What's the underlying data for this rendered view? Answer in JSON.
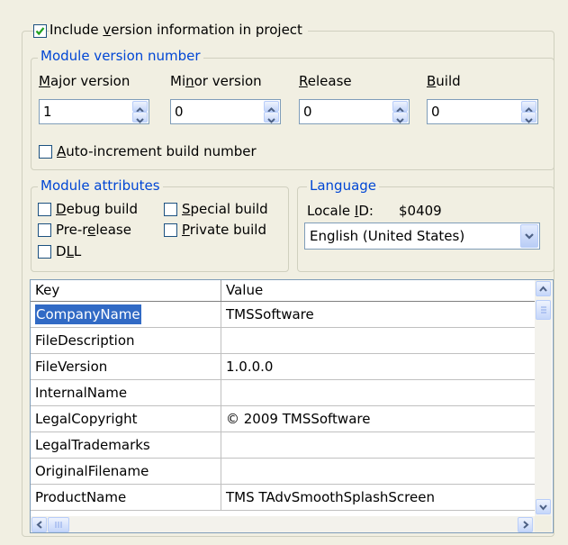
{
  "include_version": {
    "label_before": "Include ",
    "label_mnemonic": "v",
    "label_after": "ersion information in project",
    "checked": true
  },
  "module_version": {
    "title": "Module version number",
    "fields": [
      {
        "label_before": "",
        "mnemonic": "M",
        "label_after": "ajor version",
        "value": "1"
      },
      {
        "label_before": "Mi",
        "mnemonic": "n",
        "label_after": "or version",
        "value": "0"
      },
      {
        "label_before": "",
        "mnemonic": "R",
        "label_after": "elease",
        "value": "0"
      },
      {
        "label_before": "",
        "mnemonic": "B",
        "label_after": "uild",
        "value": "0"
      }
    ],
    "auto_increment": {
      "mnemonic": "A",
      "label_after": "uto-increment build number",
      "checked": false
    }
  },
  "module_attributes": {
    "title": "Module attributes",
    "debug": {
      "before": "",
      "mnemonic": "D",
      "after": "ebug build",
      "checked": false
    },
    "prerelease": {
      "before": "Pre-r",
      "mnemonic": "e",
      "after": "lease",
      "checked": false
    },
    "dll": {
      "before": "D",
      "mnemonic": "L",
      "after": "L",
      "checked": false
    },
    "special": {
      "before": "",
      "mnemonic": "S",
      "after": "pecial build",
      "checked": false
    },
    "private": {
      "before": "",
      "mnemonic": "P",
      "after": "rivate build",
      "checked": false
    }
  },
  "language": {
    "title": "Language",
    "locale_before": "Locale ",
    "locale_mnemonic": "I",
    "locale_after": "D:",
    "locale_value": "$0409",
    "selected": "English (United States)"
  },
  "grid": {
    "columns": [
      "Key",
      "Value"
    ],
    "rows": [
      {
        "key": "CompanyName",
        "value": "TMSSoftware"
      },
      {
        "key": "FileDescription",
        "value": ""
      },
      {
        "key": "FileVersion",
        "value": "1.0.0.0"
      },
      {
        "key": "InternalName",
        "value": ""
      },
      {
        "key": "LegalCopyright",
        "value": "© 2009 TMSSoftware"
      },
      {
        "key": "LegalTrademarks",
        "value": ""
      },
      {
        "key": "OriginalFilename",
        "value": ""
      },
      {
        "key": "ProductName",
        "value": "TMS TAdvSmoothSplashScreen"
      }
    ],
    "selected_row": 0
  },
  "colors": {
    "accent": "#0046d5",
    "selection": "#316ac5",
    "check": "#21a121"
  }
}
